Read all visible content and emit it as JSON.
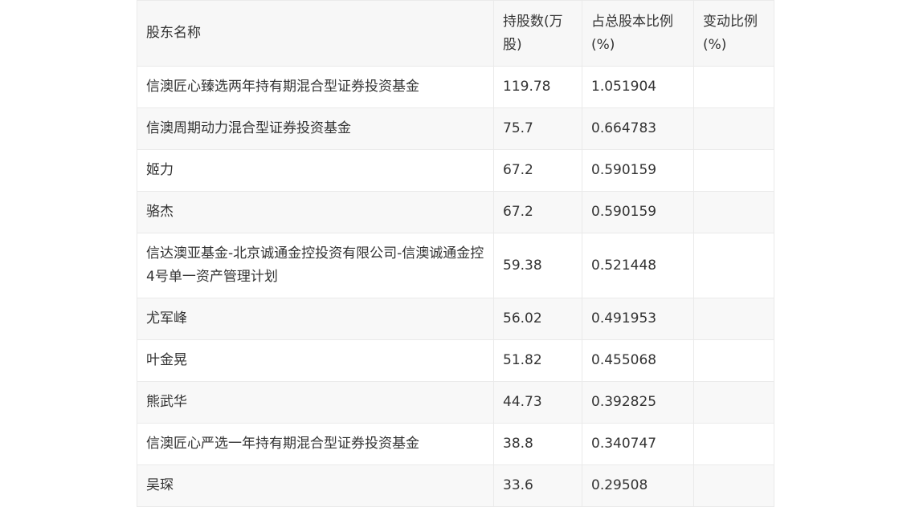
{
  "table": {
    "headers": {
      "name": "股东名称",
      "shares": "持股数(万股)",
      "ratio": "占总股本比例(%)",
      "change": "变动比例(%)"
    },
    "rows": [
      {
        "name": "信澳匠心臻选两年持有期混合型证券投资基金",
        "shares": "119.78",
        "ratio": "1.051904",
        "change": ""
      },
      {
        "name": "信澳周期动力混合型证券投资基金",
        "shares": "75.7",
        "ratio": "0.664783",
        "change": ""
      },
      {
        "name": "姬力",
        "shares": "67.2",
        "ratio": "0.590159",
        "change": ""
      },
      {
        "name": "骆杰",
        "shares": "67.2",
        "ratio": "0.590159",
        "change": ""
      },
      {
        "name": "信达澳亚基金-北京诚通金控投资有限公司-信澳诚通金控4号单一资产管理计划",
        "shares": "59.38",
        "ratio": "0.521448",
        "change": ""
      },
      {
        "name": "尤军峰",
        "shares": "56.02",
        "ratio": "0.491953",
        "change": ""
      },
      {
        "name": "叶金晃",
        "shares": "51.82",
        "ratio": "0.455068",
        "change": ""
      },
      {
        "name": "熊武华",
        "shares": "44.73",
        "ratio": "0.392825",
        "change": ""
      },
      {
        "name": "信澳匠心严选一年持有期混合型证券投资基金",
        "shares": "38.8",
        "ratio": "0.340747",
        "change": ""
      },
      {
        "name": "吴琛",
        "shares": "33.6",
        "ratio": "0.29508",
        "change": ""
      }
    ]
  }
}
